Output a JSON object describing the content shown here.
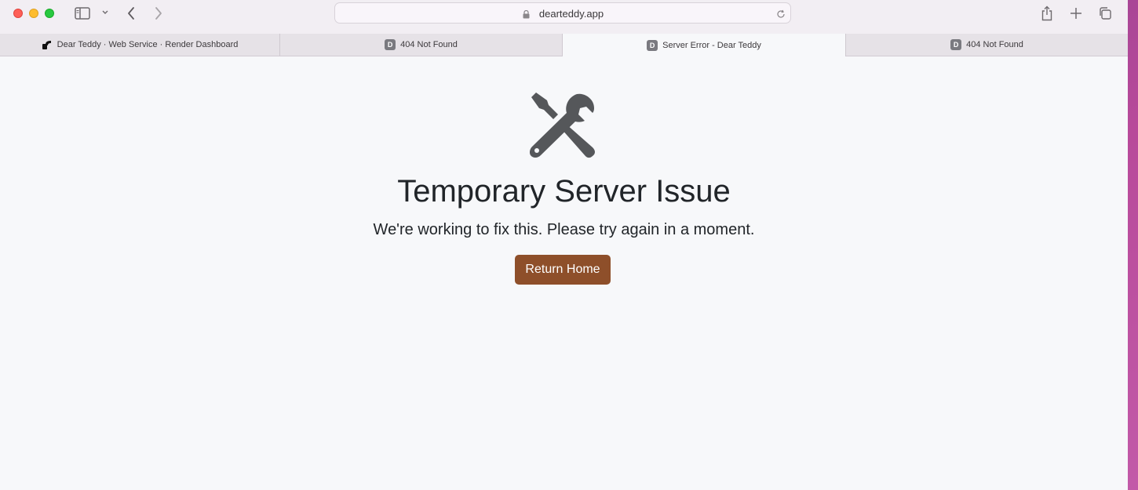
{
  "browser": {
    "address": "dearteddy.app",
    "tabs": [
      {
        "label": "Dear Teddy · Web Service · Render Dashboard",
        "favicon": "render-logo"
      },
      {
        "label": "404 Not Found",
        "favicon": "D"
      },
      {
        "label": "Server Error - Dear Teddy",
        "favicon": "D"
      },
      {
        "label": "404 Not Found",
        "favicon": "D"
      }
    ]
  },
  "page": {
    "icon": "tools-icon",
    "heading": "Temporary Server Issue",
    "message": "We're working to fix this. Please try again in a moment.",
    "button_label": "Return Home"
  },
  "colors": {
    "accent": "#8e4f2a",
    "icon": "#55575a",
    "background": "#f7f8fa"
  }
}
